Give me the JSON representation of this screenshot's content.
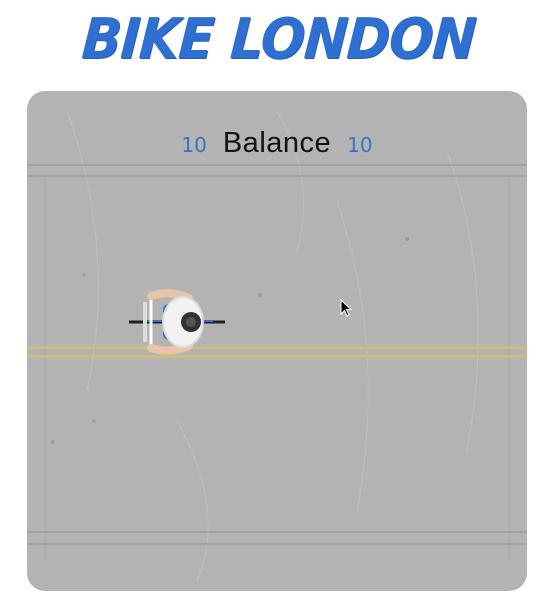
{
  "app": {
    "title": "BIKE LONDON"
  },
  "hud": {
    "left_value": "10",
    "label": "Balance",
    "right_value": "10"
  },
  "colors": {
    "title": "#2e6fd1",
    "road": "#b3b3b3",
    "center_line": "#c9bd7f",
    "hud_numbers": "#3a72c4"
  },
  "icons": {
    "player": "cyclist-top-view",
    "cursor": "mouse-pointer"
  }
}
